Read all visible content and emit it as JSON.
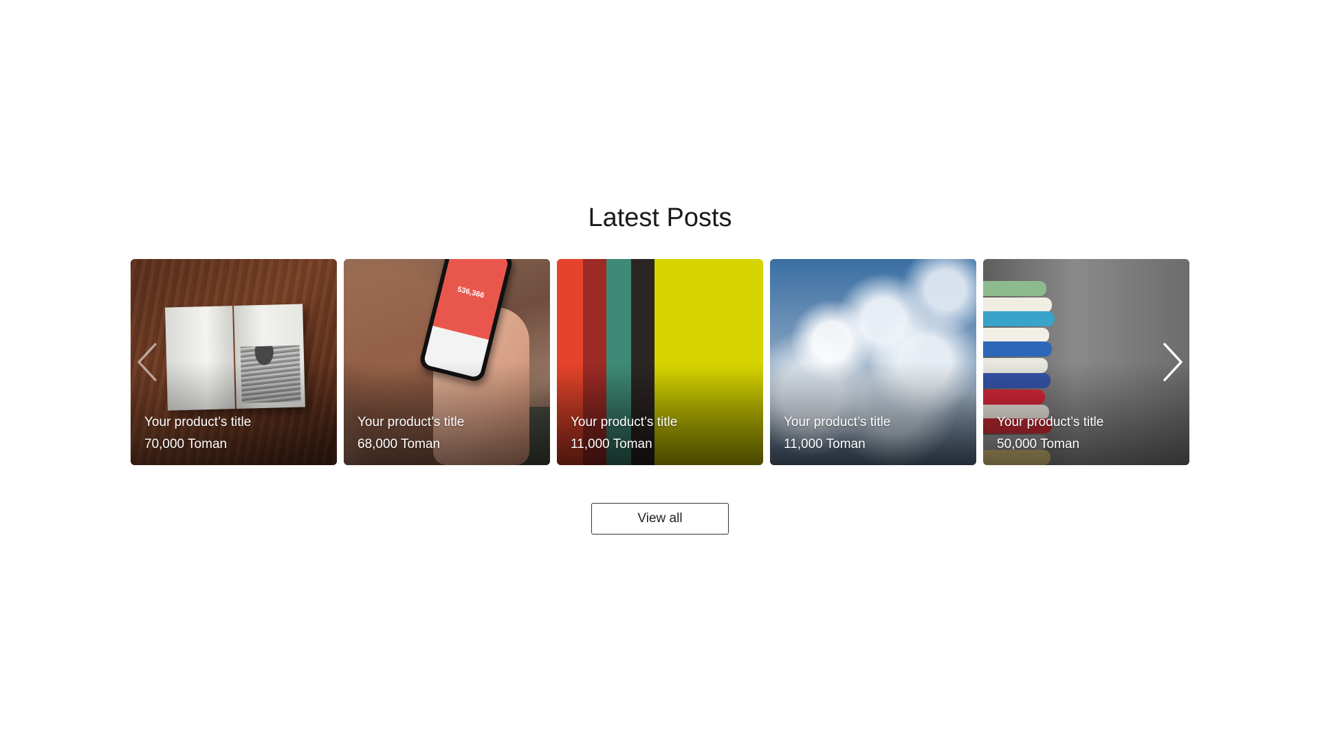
{
  "section": {
    "title": "Latest Posts"
  },
  "carousel": {
    "prev_icon": "chevron-left-icon",
    "next_icon": "chevron-right-icon",
    "items": [
      {
        "title": "Your product’s title",
        "price": "70,000 Toman",
        "image": "open-book-on-wooden-table"
      },
      {
        "title": "Your product’s title",
        "price": "68,000 Toman",
        "image": "hand-holding-phone",
        "screen_text": "536,366"
      },
      {
        "title": "Your product’s title",
        "price": "11,000 Toman",
        "image": "colored-stripes"
      },
      {
        "title": "Your product’s title",
        "price": "11,000 Toman",
        "image": "clouds-in-blue-sky"
      },
      {
        "title": "Your product’s title",
        "price": "50,000 Toman",
        "image": "stack-of-books"
      }
    ]
  },
  "view_all": {
    "label": "View all"
  },
  "colors": {
    "background": "#ffffff",
    "text": "#1a1a1a",
    "card_text": "#ffffff",
    "button_border": "#333333"
  }
}
